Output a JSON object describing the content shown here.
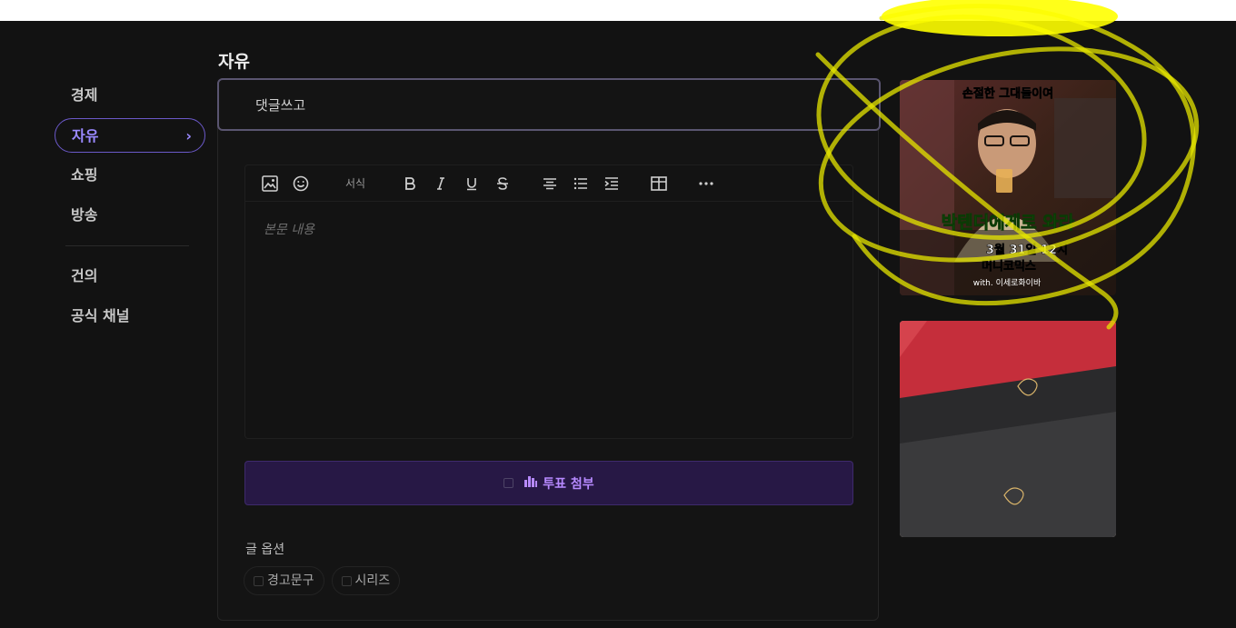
{
  "page": {
    "title": "자유"
  },
  "sidebar": {
    "items": [
      {
        "label": "경제",
        "active": false
      },
      {
        "label": "자유",
        "active": true
      },
      {
        "label": "쇼핑",
        "active": false
      },
      {
        "label": "방송",
        "active": false
      },
      {
        "label": "건의",
        "active": false
      },
      {
        "label": "공식 채널",
        "active": false
      }
    ],
    "chevron": "›"
  },
  "post": {
    "title_value": "댓글쓰고",
    "body_placeholder": "본문 내용"
  },
  "toolbar": {
    "format_label": "서식",
    "icons": [
      "image-icon",
      "emoji-icon",
      "bold-icon",
      "italic-icon",
      "underline-icon",
      "strikethrough-icon",
      "align-center-icon",
      "bullet-list-icon",
      "indent-icon",
      "table-icon",
      "more-icon"
    ]
  },
  "vote": {
    "label": "투표 첨부",
    "icon": "bar-chart-icon"
  },
  "options": {
    "label": "글 옵션",
    "items": [
      {
        "label": "경고문구"
      },
      {
        "label": "시리즈"
      }
    ]
  },
  "ads": {
    "ad1": {
      "line1": "손절한 그대들이여",
      "line2": "박텐더에게로 와라",
      "line3": "3월 31일 12시",
      "line4": "머니코믹스",
      "line5": "with. 이세로화이바"
    }
  },
  "colors": {
    "background": "#121212",
    "accent": "#9a89ff",
    "vote_bg": "#271845",
    "ad_green": "#4ee03a",
    "ad_yellow": "#ffff00"
  }
}
